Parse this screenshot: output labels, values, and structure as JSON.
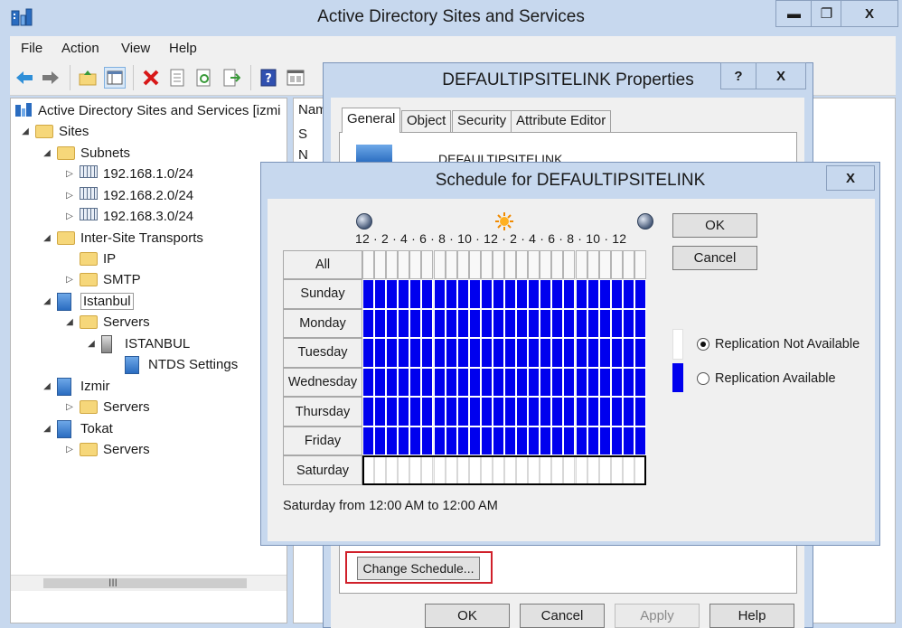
{
  "main_window": {
    "title": "Active Directory Sites and Services",
    "controls": {
      "minimize": "▬",
      "maximize": "❐",
      "close": "X"
    }
  },
  "menubar": {
    "items": [
      "File",
      "Action",
      "View",
      "Help"
    ]
  },
  "toolbar": {
    "icons": [
      "back-icon",
      "forward-icon",
      "up-folder-icon",
      "show-tree-icon",
      "delete-icon",
      "properties-icon",
      "refresh-icon",
      "export-list-icon",
      "help-icon",
      "mmc-icon"
    ]
  },
  "tree": {
    "root": "Active Directory Sites and Services [izmi",
    "sites": "Sites",
    "subnets": "Subnets",
    "subnet_items": [
      "192.168.1.0/24",
      "192.168.2.0/24",
      "192.168.3.0/24"
    ],
    "inter_site_transports": "Inter-Site Transports",
    "ip": "IP",
    "smtp": "SMTP",
    "istanbul": "Istanbul",
    "istanbul_servers": "Servers",
    "istanbul_server": "ISTANBUL",
    "ntds": "NTDS Settings",
    "izmir": "Izmir",
    "izmir_servers": "Servers",
    "tokat": "Tokat",
    "tokat_servers": "Servers",
    "scroll_grip": "III"
  },
  "list_pane": {
    "name_header": "Nam",
    "row1": "S",
    "row2": "N"
  },
  "properties_dialog": {
    "title": "DEFAULTIPSITELINK Properties",
    "help_btn": "?",
    "close_btn": "X",
    "tabs": [
      "General",
      "Object",
      "Security",
      "Attribute Editor"
    ],
    "name_text": "DEFAULTIPSITELINK",
    "change_schedule": "Change Schedule...",
    "buttons": {
      "ok": "OK",
      "cancel": "Cancel",
      "apply": "Apply",
      "help": "Help"
    }
  },
  "schedule_dialog": {
    "title": "Schedule for DEFAULTIPSITELINK",
    "close_btn": "X",
    "hours_label": "12 · 2 · 4 · 6 · 8 · 10 · 12 · 2 · 4 · 6 · 8 · 10 · 12",
    "all_label": "All",
    "days": [
      "Sunday",
      "Monday",
      "Tuesday",
      "Wednesday",
      "Thursday",
      "Friday",
      "Saturday"
    ],
    "availability": [
      1,
      1,
      1,
      1,
      1,
      1,
      0
    ],
    "hours_per_day": 24,
    "ok": "OK",
    "cancel": "Cancel",
    "legend": {
      "not_available": "Replication Not Available",
      "available": "Replication Available",
      "selected": "not_available"
    },
    "status": "Saturday from 12:00 AM to 12:00 AM",
    "colors": {
      "available": "#0000ee",
      "not_available": "#ffffff"
    }
  }
}
